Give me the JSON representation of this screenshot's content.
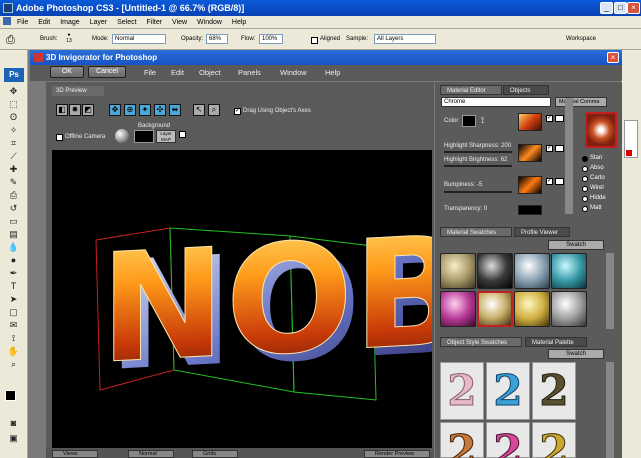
{
  "ps": {
    "title": "Adobe Photoshop CS3 - [Untitled-1 @ 66.7% (RGB/8)]",
    "menu": [
      "File",
      "Edit",
      "Image",
      "Layer",
      "Select",
      "Filter",
      "View",
      "Window",
      "Help"
    ],
    "options": {
      "brush_label": "Brush:",
      "brush_size": "13",
      "mode_label": "Mode:",
      "mode_value": "Normal",
      "opacity_label": "Opacity:",
      "opacity_value": "68%",
      "flow_label": "Flow:",
      "flow_value": "100%",
      "aligned_label": "Aligned",
      "sample_label": "Sample:",
      "sample_value": "All Layers",
      "workspace_label": "Workspace"
    },
    "logo": "Ps"
  },
  "plugin": {
    "title": "3D Invigorator for Photoshop",
    "ok": "OK",
    "cancel": "Cancel",
    "menu": [
      "File",
      "Edit",
      "Object",
      "Panels",
      "Window",
      "Help"
    ],
    "preview_tab": "3D Preview",
    "drag_axes": "Drag Using Object's Axes",
    "offline_camera": "Offline Camera",
    "background_label": "Background",
    "layer_map": "Layer MAP",
    "bottom": {
      "views": "Views",
      "normal": "Normal",
      "grids": "Grids",
      "render": "Render Preview"
    },
    "viewport_text": "NOB"
  },
  "material_editor": {
    "tab": "Material Editor",
    "objects_tab": "Objects",
    "name_value": "Chrome",
    "material_commands": "Material Comma",
    "color_label": "Color",
    "highlight_sharpness": "Highlight Sharpness: 200",
    "highlight_brightness": "Highlight Brightness: 62",
    "bumpiness": "Bumpiness: -5",
    "transparency": "Transparency: 0",
    "radio_options": [
      "Stan",
      "Abso",
      "Carto",
      "Wirel",
      "Hidde",
      "Matt"
    ]
  },
  "swatches": {
    "tab": "Material Swatches",
    "profile_tab": "Profile Viewer",
    "dropdown": "Swatch",
    "colors": [
      "#a89a6a",
      "#3a3a3a",
      "#8aa4b4",
      "#3a9aa8",
      "#b83a98",
      "#c8b068",
      "#d0b040",
      "#a0a0a0"
    ]
  },
  "object_styles": {
    "tab": "Object Style Swatches",
    "palette_tab": "Material Palette",
    "dropdown": "Swatch",
    "glyph": "2",
    "colors": [
      "#e8b8c8",
      "#3aa0d8",
      "#5a5030",
      "#c87838",
      "#d84898",
      "#c8a830"
    ]
  }
}
